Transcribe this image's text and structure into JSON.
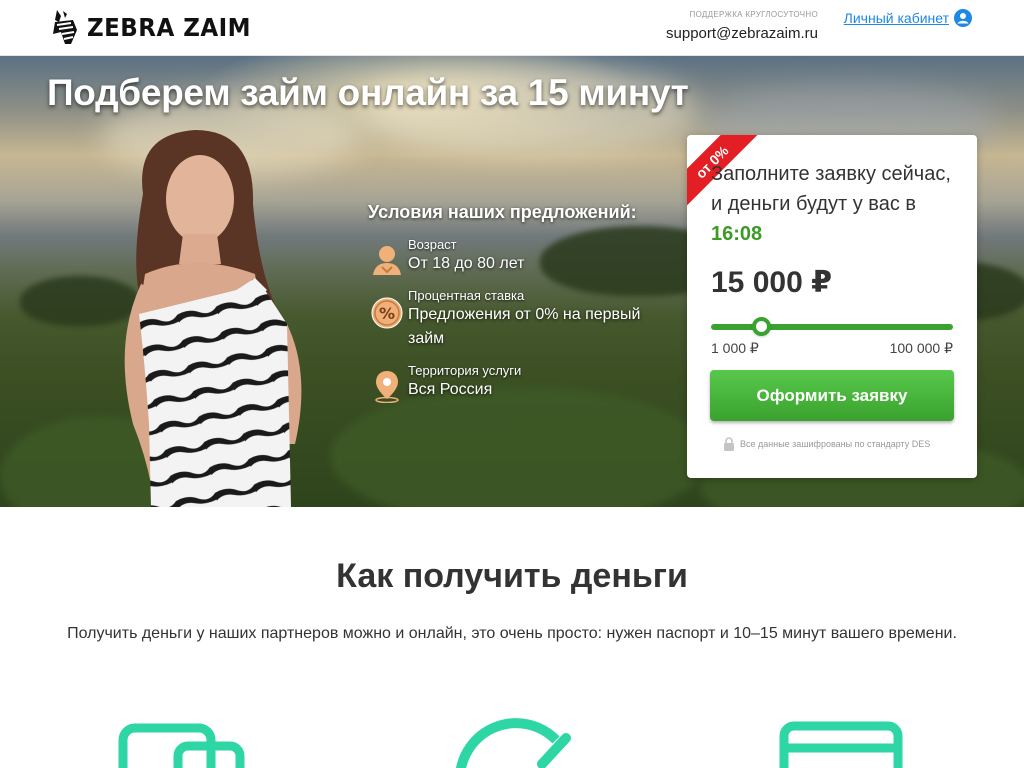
{
  "header": {
    "logo_text": "ZEBRA ZAIM",
    "support_caption": "ПОДДЕРЖКА КРУГЛОСУТОЧНО",
    "support_email": "support@zebrazaim.ru",
    "cabinet_link": "Личный кабинет",
    "cabinet_icon": "user-circle-icon"
  },
  "hero": {
    "title": "Подберем займ онлайн за 15 минут",
    "offers_title": "Условия наших предложений:",
    "offers": [
      {
        "icon": "person-icon",
        "label": "Возраст",
        "value": "От 18 до 80 лет"
      },
      {
        "icon": "percent-icon",
        "label": "Процентная ставка",
        "value": "Предложения от 0% на первый займ"
      },
      {
        "icon": "location-pin-icon",
        "label": "Территория услуги",
        "value": "Вся Россия"
      }
    ]
  },
  "form": {
    "ribbon": "от 0%",
    "text": "Заполните заявку сейчас, и деньги будут у вас в",
    "time": "16:08",
    "amount": "15 000 ₽",
    "slider": {
      "min_label": "1 000 ₽",
      "max_label": "100 000 ₽",
      "min": 1000,
      "max": 100000,
      "value": 15000
    },
    "submit_label": "Оформить заявку",
    "secure_note": "Все данные зашифрованы по стандарту DES"
  },
  "how": {
    "title": "Как получить деньги",
    "description": "Получить деньги у наших партнеров можно и онлайн, это очень просто: нужен паспорт и 10–15 минут вашего времени.",
    "steps": [
      {
        "icon": "devices-icon"
      },
      {
        "icon": "timer-icon"
      },
      {
        "icon": "card-icon"
      }
    ]
  },
  "colors": {
    "accent_green": "#3aa22e",
    "ribbon_red": "#e31e24",
    "link_blue": "#1e88e5",
    "step_icon_teal": "#2dd6a4"
  }
}
